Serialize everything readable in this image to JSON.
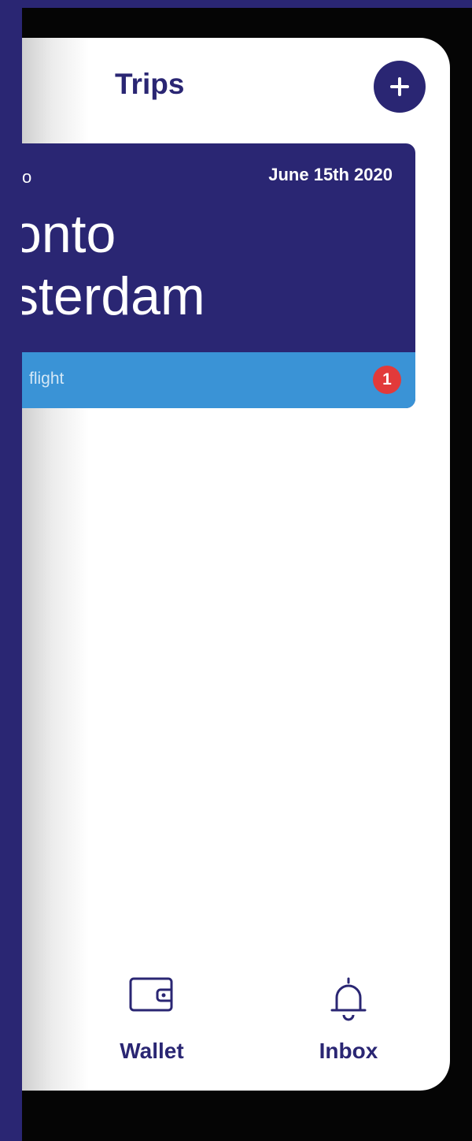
{
  "header": {
    "title": "Trips",
    "add_icon": "plus-icon"
  },
  "trip": {
    "from_partial": "o",
    "date": "June 15th 2020",
    "route_line1": "onto",
    "route_line2": "sterdam",
    "flight_label": "flight",
    "badge_count": "1"
  },
  "bottom_nav": {
    "wallet": {
      "label": "Wallet",
      "icon": "wallet-icon"
    },
    "inbox": {
      "label": "Inbox",
      "icon": "bell-icon"
    }
  },
  "colors": {
    "brand_navy": "#2a2673",
    "flight_bar_blue": "#3a93d6",
    "badge_red": "#e23a3a",
    "background_dark": "#050505"
  }
}
